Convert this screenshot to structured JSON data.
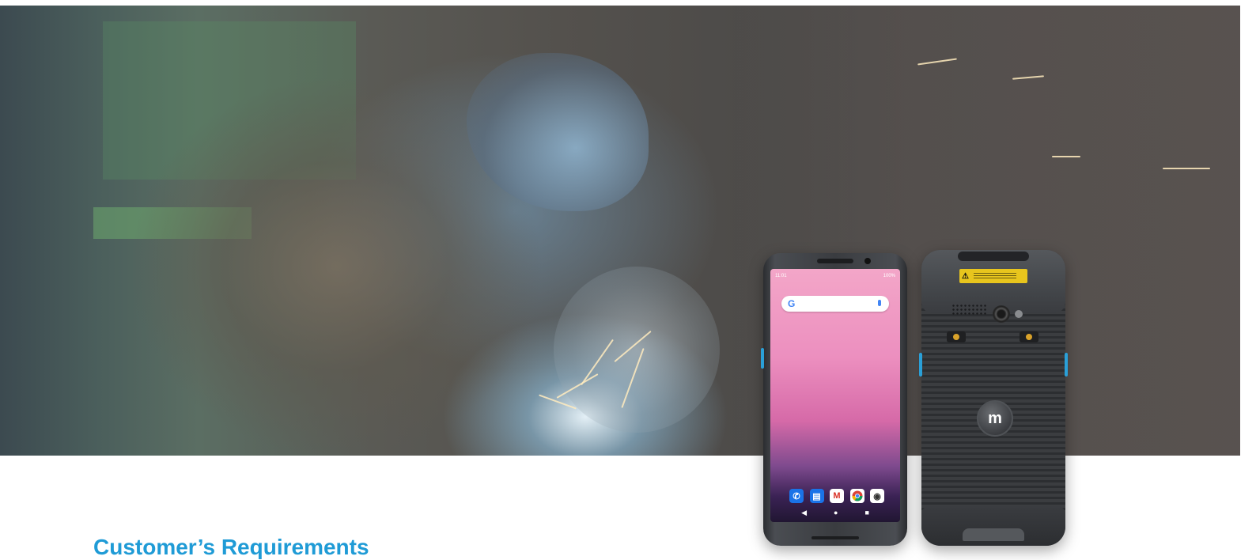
{
  "hero": {
    "image_description_icon": "welding-worker-photo",
    "accent_color": "#1f9bd6"
  },
  "section": {
    "title": "Customer’s Requirements"
  },
  "device_front": {
    "status_time": "11:01",
    "status_battery": "100%",
    "search_logo": "G",
    "dock_apps": [
      "phone-icon",
      "messages-icon",
      "gmail-icon",
      "chrome-icon",
      "camera-icon"
    ],
    "nav_buttons": [
      "◀",
      "●",
      "■"
    ]
  },
  "device_back": {
    "logo_glyph": "m",
    "warning_symbol": "⚠"
  }
}
